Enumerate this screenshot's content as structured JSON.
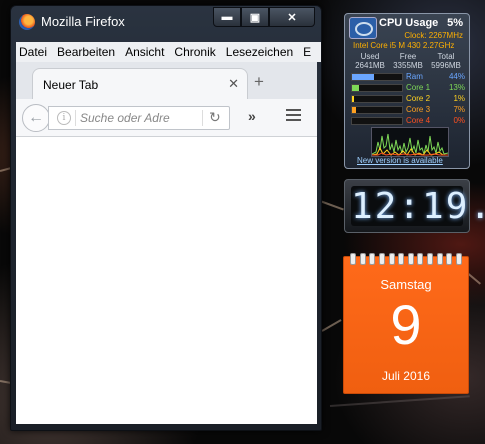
{
  "window": {
    "title": "Mozilla Firefox",
    "buttons": {
      "minimize": "▬",
      "maximize": "▣",
      "close": "✕"
    }
  },
  "menubar": {
    "items": [
      {
        "label": "Datei"
      },
      {
        "label": "Bearbeiten"
      },
      {
        "label": "Ansicht"
      },
      {
        "label": "Chronik"
      },
      {
        "label": "Lesezeichen"
      },
      {
        "label": "E"
      }
    ]
  },
  "tabs": [
    {
      "label": "Neuer Tab",
      "close": "✕"
    }
  ],
  "newtab_label": "+",
  "navbar": {
    "back_icon": "←",
    "info_icon": "i",
    "search_placeholder": "Suche oder Adre",
    "reload_icon": "↻",
    "overflow_icon": "»"
  },
  "cpu_gadget": {
    "title": "CPU Usage",
    "total_percent": "5%",
    "clock": "Clock: 2267MHz",
    "model": "Intel Core i5 M 430 2.27GHz",
    "memory": {
      "headers": [
        "Used",
        "Free",
        "Total"
      ],
      "values": [
        "2641MB",
        "3355MB",
        "5996MB"
      ]
    },
    "rows": [
      {
        "label": "Ram",
        "value": "44%",
        "fraction": 0.44,
        "color": "#6aa6ff"
      },
      {
        "label": "Core 1",
        "value": "13%",
        "fraction": 0.13,
        "color": "#7ed957"
      },
      {
        "label": "Core 2",
        "value": "1%",
        "fraction": 0.01,
        "color": "#ffd21f"
      },
      {
        "label": "Core 3",
        "value": "7%",
        "fraction": 0.07,
        "color": "#ffa020"
      },
      {
        "label": "Core 4",
        "value": "0%",
        "fraction": 0.0,
        "color": "#ff5020"
      }
    ],
    "link": "New version is available"
  },
  "clock_gadget": {
    "time": "12:19."
  },
  "calendar_gadget": {
    "weekday": "Samstag",
    "day": "9",
    "month_year": "Juli 2016"
  },
  "colors": {
    "accent_orange": "#f05f10",
    "cpu_highlight": "#ffb000"
  }
}
